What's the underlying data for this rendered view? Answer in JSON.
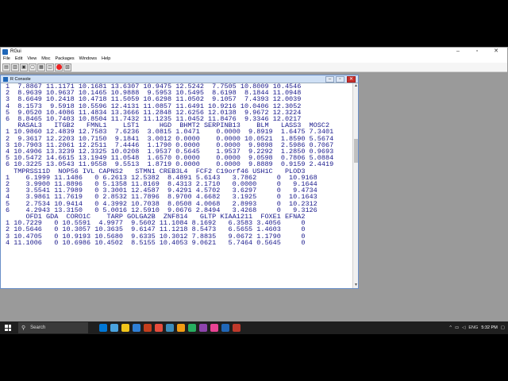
{
  "app": {
    "title": "RGui",
    "menus": [
      "File",
      "Edit",
      "View",
      "Misc",
      "Packages",
      "Windows",
      "Help"
    ],
    "window_controls": [
      "–",
      "▫",
      "✕"
    ]
  },
  "console": {
    "title": "R Console",
    "lines": [
      "1  7.8867 11.1171 10.1681 13.6307 10.9475 12.5242  7.7505 10.8009 10.4546",
      "2  8.9639 10.9637 10.1465 10.9888  9.5953 10.5495  8.6198  8.1844 11.0948",
      "3  8.6649 10.2418 10.4718 11.5059 10.6298 11.0502  9.1057  7.4393 12.0039",
      "4  8.1573  9.5918 10.5596 12.4131 11.0857 11.6491 10.9216 10.0406 12.3052",
      "5  9.0520 10.4086 11.4834 13.3666 11.2848 12.6256 12.0138  9.9672 12.3224",
      "6  8.8465 10.7403 10.8504 11.7432 11.1235 11.0452 11.8476  9.3346 12.0217",
      "   RASAL3   ITGB2   FMNL1    LST1     HGD  BHMT2 SERPINB13    BLM   LASS3  MOSC2",
      "1 10.9860 12.4839 12.7583  7.6236  3.0815 1.0471    0.0000  9.8919  1.6475 7.3401",
      "2  9.3617 12.2203 10.7150  9.1841  3.0012 0.0000    0.0000 10.0521  1.8590 5.5674",
      "3 10.7903 11.2061 12.2511  7.4446  1.1790 0.0000    0.0000  9.9898  2.5986 0.7067",
      "4 10.4906 13.3239 12.3325 10.0208  1.9537 0.5645    1.9537  9.2292  1.2850 0.9693",
      "5 10.5472 14.6615 13.1949 11.0548  1.6570 0.0000    0.0000  9.0598  0.7806 5.0884",
      "6 10.3225 13.0543 11.9558  9.5513  1.8719 0.0000    0.0000  9.8889  0.9159 2.4419",
      "  TMPRSS11D  NOP56 IVL CAPNS2   STMN1 CREB3L4  FCF2 C19orf46 USH1C   PLOD3",
      "1    6.1999 11.1486   0 6.2613 12.5382  8.4891 5.6143   3.7862     0  10.9168",
      "2    3.9900 11.8896   0 5.1358 11.8169  8.4313 2.1710   0.0000     0   9.1644",
      "3    3.5541 11.7989   0 3.3001 12.4587  9.4291 4.5702   3.6297     0   9.4734",
      "4    3.9861 11.7619   0 2.8532 11.7896  8.9700 4.6682   3.1925     0  10.1643",
      "5    2.7534 10.9414   0 4.3992 10.7038  8.0508 4.0068   2.8993     0  10.2312",
      "6    4.2943 13.3150   0 5.0016 12.5910  9.0676 2.8494   3.4268     0   9.3126",
      "     OFD1 GDA  CORO1C    TARP GOLGA2B  ZNF814   GLTP KIAA1211  FOXE1 EFNA2",
      "1 10.7229   0 10.5591  4.9977  9.5602 11.1084 8.1692   6.3583 3.4056     0",
      "2 10.5646   0 10.3057 10.3635  9.6147 11.1218 8.5473   6.5655 1.4603     0",
      "3 10.4705   0 10.9193 10.5680  9.6335 10.3012 7.8835   9.0672 1.1790     0",
      "4 11.1006   0 10.6986 10.4502  8.5155 10.4053 9.0621   5.7464 0.5645     0"
    ]
  },
  "taskbar": {
    "search_placeholder": "Search",
    "tray_lang": "ENG",
    "time": "5:32 PM"
  },
  "colors": {
    "console_text": "#1a1a8c",
    "title_active": "#cfe0f5",
    "taskbar": "#1f1f1f"
  }
}
